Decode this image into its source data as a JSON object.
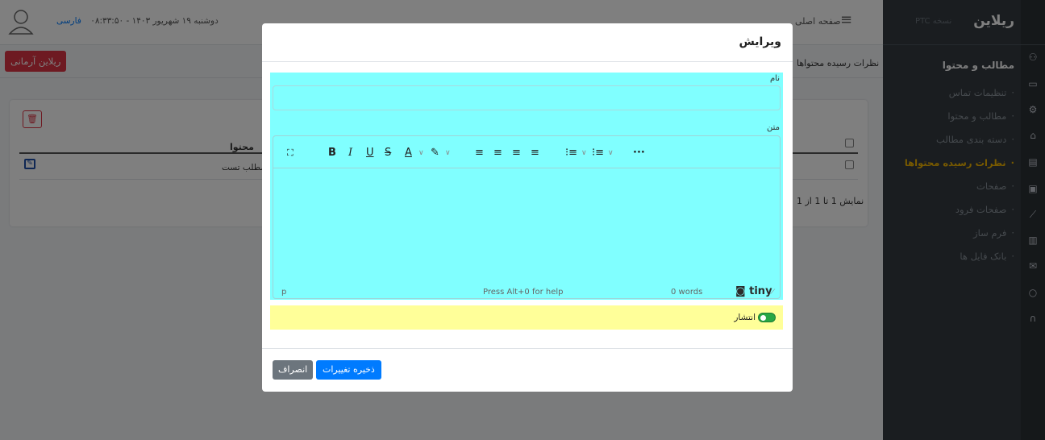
{
  "brand": {
    "logo": "ریلاین",
    "version": "PTC نسخه"
  },
  "header": {
    "date": "دوشنبه ۱۹ شهریور ۱۴۰۳ - ۰۸:۳۳:۵۰",
    "language": "فارسی",
    "home": "صفحه اصلی",
    "menu_icon": "hamburger-icon"
  },
  "sidebar": {
    "heading": "مطالب و محتوا",
    "items": [
      {
        "label": "تنظیمات تماس"
      },
      {
        "label": "مطالب و محتوا"
      },
      {
        "label": "دسته بندی مطالب"
      },
      {
        "label": "نظرات رسیده محتواها",
        "active": true
      },
      {
        "label": "صفحات"
      },
      {
        "label": "صفحات فرود"
      },
      {
        "label": "فرم ساز"
      },
      {
        "label": "بانک فایل ها"
      }
    ],
    "icons": [
      "users-icon",
      "monitor-icon",
      "settings-icon",
      "basket-icon",
      "comments-icon",
      "image-icon",
      "chart-icon",
      "clipboard-icon",
      "mail-icon",
      "chat-icon",
      "headset-icon"
    ]
  },
  "page": {
    "live_button": "ریلاین آرمانی",
    "breadcrumb": "نظرات رسیده محتواها",
    "table_header": "محتوا",
    "row_title": "مطلب تست",
    "showing": "نمایش 1 تا 1 از 1"
  },
  "modal": {
    "title": "ویرایش",
    "name_label": "نام",
    "name_value": "",
    "text_label": "متن",
    "editor": {
      "status_path": "p",
      "help": "Press Alt+0 for help",
      "word_count": "0 words",
      "brand": "tiny"
    },
    "publish_label": "انتشار",
    "publish_on": true,
    "save_button": "ذخیره تغییرات",
    "cancel_button": "انصراف"
  },
  "colors": {
    "sidebar": "#343a40",
    "active": "#f0b400",
    "primary": "#007bff",
    "danger": "#dc3545",
    "secondary": "#6c757d",
    "form_bg": "#80ffff",
    "publish_bg": "#ffff99"
  }
}
